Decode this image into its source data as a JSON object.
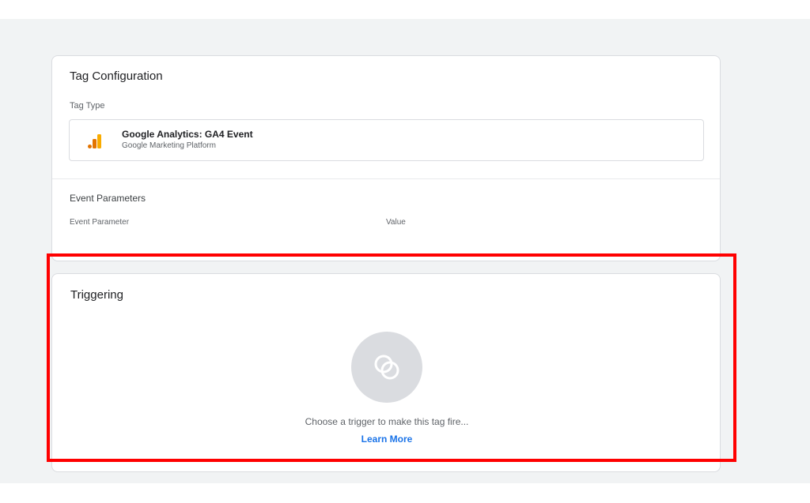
{
  "tag_configuration": {
    "title": "Tag Configuration",
    "tag_type_label": "Tag Type",
    "tag_type": {
      "name": "Google Analytics: GA4 Event",
      "provider": "Google Marketing Platform",
      "icon": "google-analytics-icon"
    },
    "event_parameters": {
      "title": "Event Parameters",
      "columns": [
        "Event Parameter",
        "Value"
      ]
    }
  },
  "triggering": {
    "title": "Triggering",
    "icon": "trigger-icon",
    "empty_message": "Choose a trigger to make this tag fire...",
    "learn_more": "Learn More"
  },
  "colors": {
    "background": "#f1f3f4",
    "card": "#ffffff",
    "link": "#1a73e8",
    "highlight": "#ff0000",
    "ga_orange": "#f9ab00",
    "ga_dark_orange": "#e37400"
  }
}
